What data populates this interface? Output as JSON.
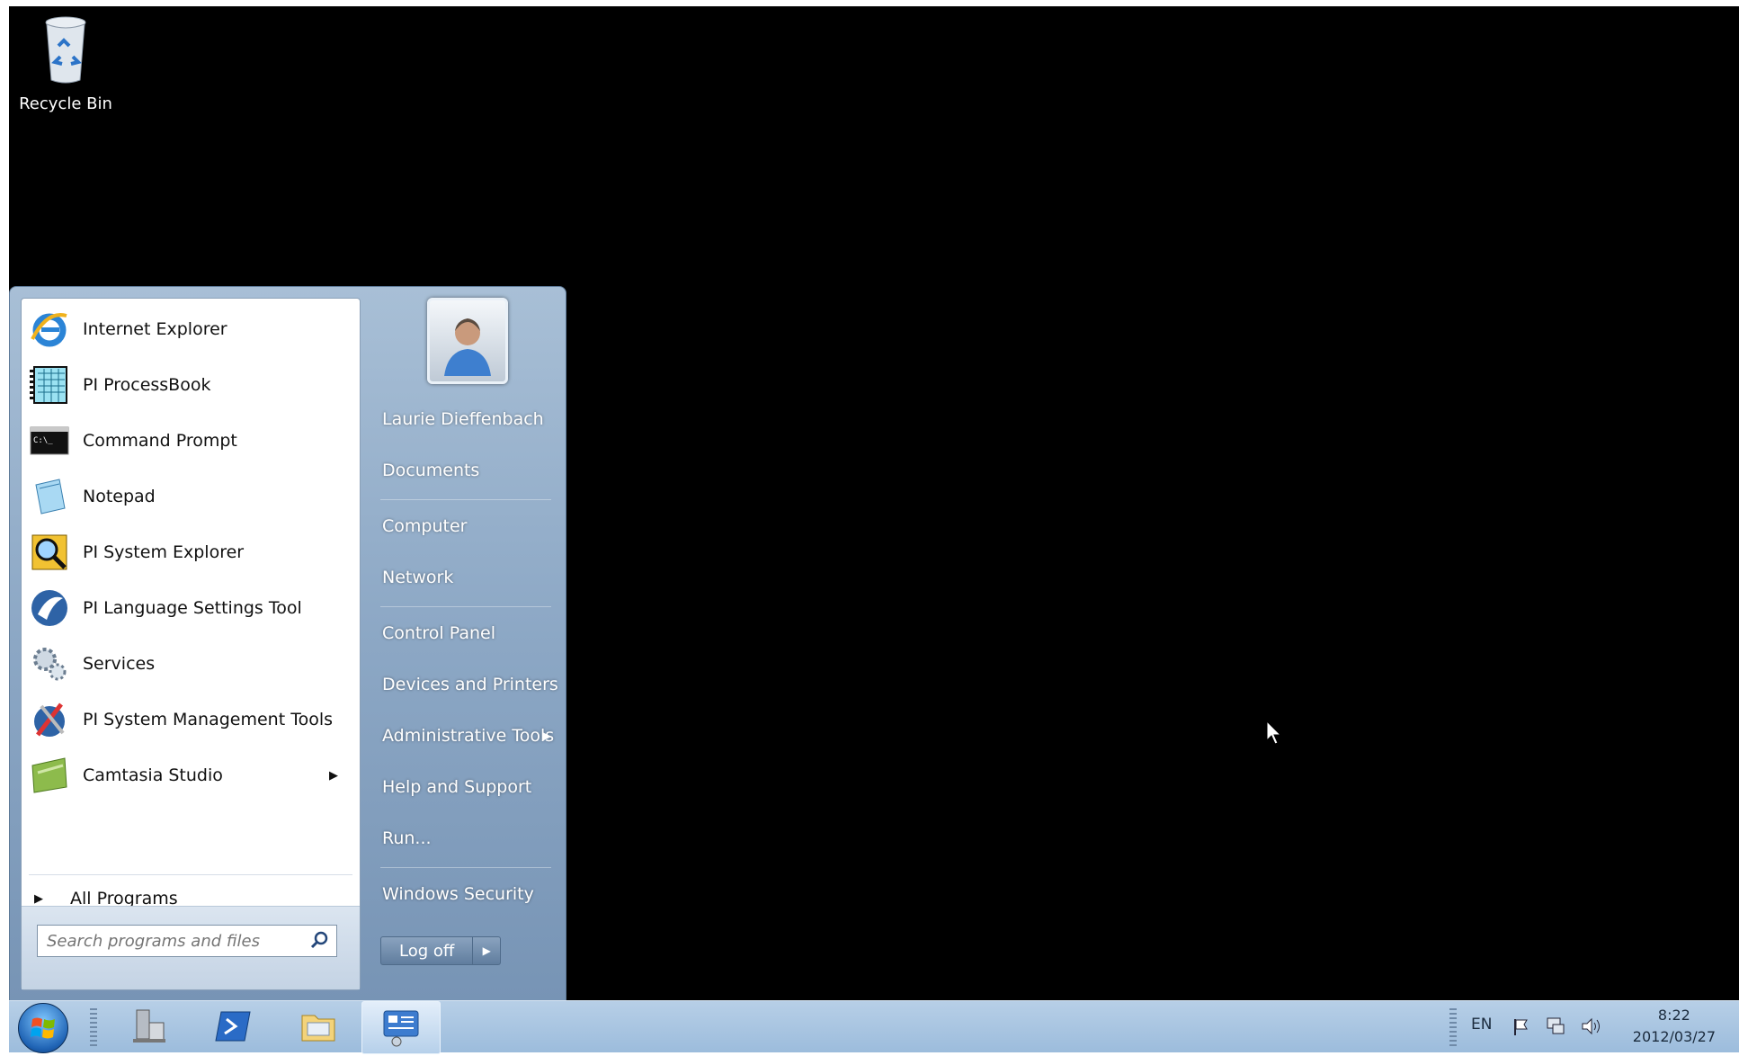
{
  "desktop": {
    "recycle_bin_label": "Recycle Bin"
  },
  "start_menu": {
    "programs": [
      {
        "label": "Internet Explorer",
        "icon": "internet-explorer-icon"
      },
      {
        "label": "PI ProcessBook",
        "icon": "processbook-icon"
      },
      {
        "label": "Command Prompt",
        "icon": "command-prompt-icon"
      },
      {
        "label": "Notepad",
        "icon": "notepad-icon"
      },
      {
        "label": "PI System Explorer",
        "icon": "pi-system-explorer-icon"
      },
      {
        "label": "PI Language Settings Tool",
        "icon": "pi-language-settings-icon"
      },
      {
        "label": "Services",
        "icon": "services-icon"
      },
      {
        "label": "PI System Management Tools",
        "icon": "pi-smt-icon"
      },
      {
        "label": "Camtasia Studio",
        "icon": "camtasia-icon"
      }
    ],
    "all_programs": "All Programs",
    "search_placeholder": "Search programs and files",
    "right_items": {
      "user": "Laurie Dieffenbach",
      "documents": "Documents",
      "computer": "Computer",
      "network": "Network",
      "control_panel": "Control Panel",
      "devices": "Devices and Printers",
      "admin_tools": "Administrative Tools",
      "help": "Help and Support",
      "run": "Run...",
      "security": "Windows Security"
    },
    "logoff_label": "Log off"
  },
  "taskbar": {
    "language": "EN",
    "time": "8:22",
    "date": "2012/03/27"
  }
}
